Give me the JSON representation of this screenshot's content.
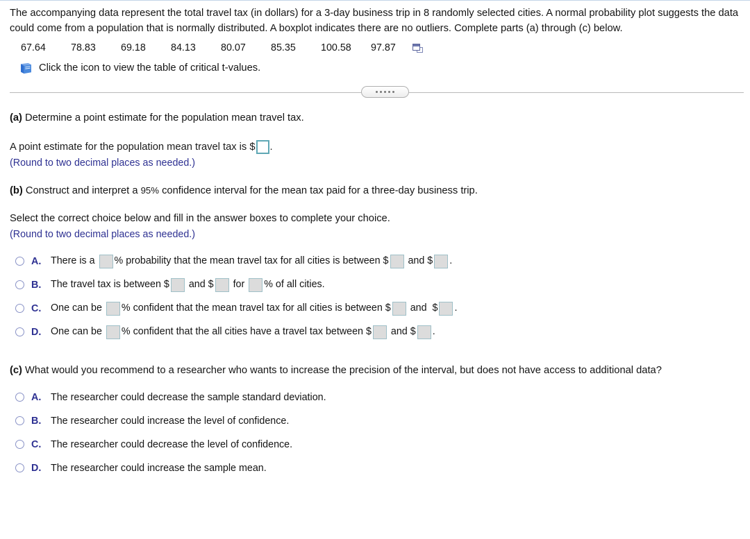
{
  "colors": {
    "hint_blue": "#2e3192",
    "letter_blue": "#2e3192",
    "radio_blue": "#8a93c7",
    "active_box_border": "#5fa8b5",
    "gray_box_fill": "#dcdcdc",
    "book_icon_blue": "#2f6fd0",
    "divider_gray": "#b9b9b9",
    "top_rule_blue": "#c3d4e8"
  },
  "prompt": {
    "text": "The accompanying data represent the total travel tax (in dollars) for a 3-day business trip in 8 randomly selected cities. A normal probability plot suggests the data could come from a population that is normally distributed. A boxplot indicates there are no outliers. Complete parts (a) through (c) below."
  },
  "data_values": [
    "67.64",
    "78.83",
    "69.18",
    "84.13",
    "80.07",
    "85.35",
    "100.58",
    "97.87"
  ],
  "icons": {
    "popout": "popout-window-icon",
    "book": "book-icon"
  },
  "table_link": {
    "label": "Click the icon to view the table of critical t-values."
  },
  "divider": {
    "dots": 5
  },
  "parts": {
    "a": {
      "label": "(a)",
      "question": " Determine a point estimate for the population mean travel tax.",
      "answer_prefix": "A point estimate for the population mean travel tax is $",
      "answer_suffix": ".",
      "answer_value": "",
      "hint": "(Round to two decimal places as needed.)"
    },
    "b": {
      "label": "(b)",
      "question_pre": " Construct and interpret a ",
      "confidence_level": "95%",
      "question_post": " confidence interval for the mean tax paid for a three-day business trip.",
      "instruction": "Select the correct choice below and fill in the answer boxes to complete your choice.",
      "hint": "(Round to two decimal places as needed.)",
      "options": [
        {
          "letter": "A.",
          "segments": [
            "There is a ",
            "% probability that the mean travel tax for all cities is between $",
            " and $",
            "."
          ],
          "blanks": 3
        },
        {
          "letter": "B.",
          "segments": [
            "The travel tax is between $",
            " and $",
            " for ",
            "% of all cities."
          ],
          "blanks": 3
        },
        {
          "letter": "C.",
          "segments": [
            "One can be ",
            "% confident that the mean travel tax for all cities is between $",
            " and  $",
            "."
          ],
          "blanks": 3
        },
        {
          "letter": "D.",
          "segments": [
            "One can be ",
            "% confident that the all cities have a travel tax between $",
            " and $",
            "."
          ],
          "blanks": 3
        }
      ]
    },
    "c": {
      "label": "(c)",
      "question": " What would you recommend to a researcher who wants to increase the precision of the interval, but does not have access to additional data?",
      "options": [
        {
          "letter": "A.",
          "text": "The researcher could decrease the sample standard deviation."
        },
        {
          "letter": "B.",
          "text": "The researcher could increase the level of confidence."
        },
        {
          "letter": "C.",
          "text": "The researcher could decrease the level of confidence."
        },
        {
          "letter": "D.",
          "text": "The researcher could increase the sample mean."
        }
      ]
    }
  }
}
